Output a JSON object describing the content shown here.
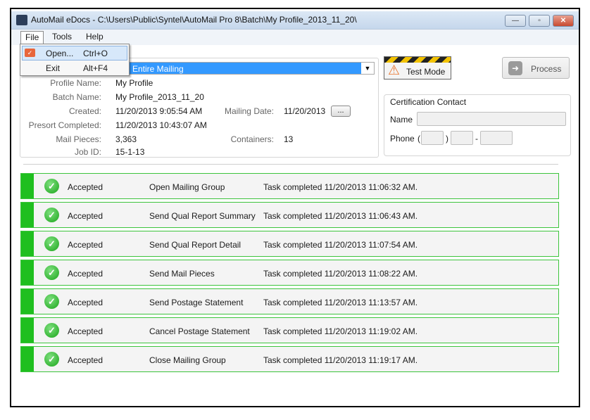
{
  "window": {
    "title": "AutoMail eDocs - C:\\Users\\Public\\Syntel\\AutoMail Pro 8\\Batch\\My Profile_2013_11_20\\"
  },
  "menu": {
    "items": [
      "File",
      "Tools",
      "Help"
    ],
    "file_dropdown": [
      {
        "label": "Open...",
        "shortcut": "Ctrl+O",
        "icon": "open-envelope-icon"
      },
      {
        "label": "Exit",
        "shortcut": "Alt+F4"
      }
    ]
  },
  "scope_select": {
    "value": "Entire Mailing"
  },
  "details": {
    "profile_name": {
      "label": "Profile Name:",
      "value": "My Profile"
    },
    "batch_name": {
      "label": "Batch Name:",
      "value": "My Profile_2013_11_20"
    },
    "created": {
      "label": "Created:",
      "value": "11/20/2013 9:05:54 AM"
    },
    "mailing_date": {
      "label": "Mailing Date:",
      "value": "11/20/2013",
      "button": "..."
    },
    "presort_completed": {
      "label": "Presort Completed:",
      "value": "11/20/2013 10:43:07 AM"
    },
    "mail_pieces": {
      "label": "Mail Pieces:",
      "value": "3,363"
    },
    "containers": {
      "label": "Containers:",
      "value": "13"
    },
    "job_id": {
      "label": "Job ID:",
      "value": "15-1-13"
    }
  },
  "test_mode": {
    "label": "Test Mode"
  },
  "process": {
    "label": "Process"
  },
  "certification": {
    "title": "Certification Contact",
    "name_label": "Name",
    "phone_label": "Phone",
    "open_paren": "(",
    "close_paren": ")",
    "dash": "-"
  },
  "tasks": [
    {
      "status": "Accepted",
      "name": "Open Mailing Group",
      "message": "Task completed 11/20/2013 11:06:32 AM."
    },
    {
      "status": "Accepted",
      "name": "Send Qual Report Summary",
      "message": "Task completed 11/20/2013 11:06:43 AM."
    },
    {
      "status": "Accepted",
      "name": "Send Qual Report Detail",
      "message": "Task completed 11/20/2013 11:07:54 AM."
    },
    {
      "status": "Accepted",
      "name": "Send Mail Pieces",
      "message": "Task completed 11/20/2013 11:08:22 AM."
    },
    {
      "status": "Accepted",
      "name": "Send Postage Statement",
      "message": "Task completed 11/20/2013 11:13:57 AM."
    },
    {
      "status": "Accepted",
      "name": "Cancel Postage Statement",
      "message": "Task completed 11/20/2013 11:19:02 AM."
    },
    {
      "status": "Accepted",
      "name": "Close Mailing Group",
      "message": "Task completed 11/20/2013 11:19:17 AM."
    }
  ],
  "colors": {
    "accepted": "#1fbf1f",
    "selection": "#3399ff"
  }
}
